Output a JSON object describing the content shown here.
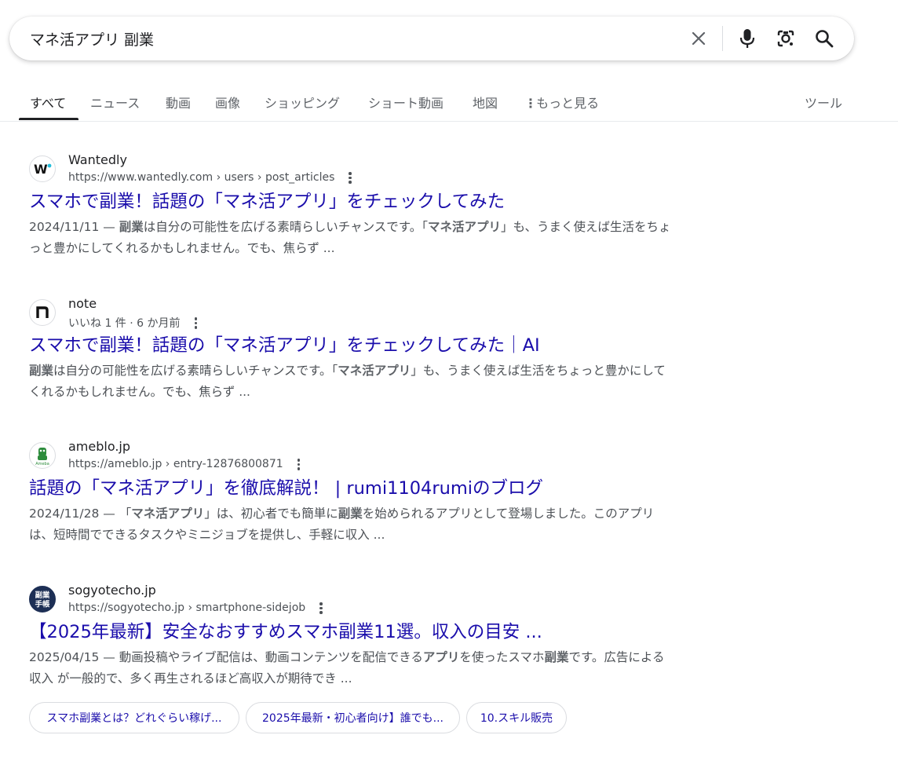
{
  "search": {
    "query": "マネ活アプリ 副業",
    "icons": [
      "close-icon",
      "mic-icon",
      "lens-icon",
      "search-icon"
    ]
  },
  "tabs": [
    {
      "label": "すべて",
      "active": true
    },
    {
      "label": "ニュース"
    },
    {
      "label": "動画"
    },
    {
      "label": "画像"
    },
    {
      "label": "ショッピング"
    },
    {
      "label": "ショート動画"
    },
    {
      "label": "地図"
    },
    {
      "label": "もっと見る"
    },
    {
      "label": "ツール"
    }
  ],
  "results": [
    {
      "site": "Wantedly",
      "url": "https://www.wantedly.com › users › post_articles",
      "title": "スマホで副業！話題の「マネ活アプリ」をチェックしてみた",
      "snippet_parts": [
        "2024/11/11 — ",
        "副業",
        "は自分の可能性を広げる素晴らしいチャンスです。「",
        "マネ活アプリ",
        "」も、うまく使えば生活をちょっと豊かにしてくれるかもしれません。でも、焦らず ..."
      ]
    },
    {
      "site": "note",
      "url": "いいね 1 件 · 6 か月前",
      "title": "スマホで副業！話題の「マネ活アプリ」をチェックしてみた｜AI",
      "snippet_parts": [
        "",
        "副業",
        "は自分の可能性を広げる素晴らしいチャンスです。「",
        "マネ活アプリ",
        "」も、うまく使えば生活をちょっと豊かにしてくれるかもしれません。でも、焦らず ..."
      ]
    },
    {
      "site": "ameblo.jp",
      "url": "https://ameblo.jp › entry-12876800871",
      "title": "話題の「マネ活アプリ」を徹底解説！ | rumi1104rumiのブログ",
      "snippet_parts": [
        "2024/11/28 — 「",
        "マネ活アプリ",
        "」は、初心者でも簡単に",
        "副業",
        "を始められるアプリとして登場しました。このアプリは、短時間でできるタスクやミニジョブを提供し、手軽に収入 ..."
      ]
    },
    {
      "site": "sogyotecho.jp",
      "url": "https://sogyotecho.jp › smartphone-sidejob",
      "title": "【2025年最新】安全なおすすめスマホ副業11選。収入の目安 ...",
      "snippet_parts": [
        "2025/04/15 — 動画投稿やライブ配信は、動画コンテンツを配信できる",
        "アプリ",
        "を使ったスマホ",
        "副業",
        "です。広告による収入 が一般的で、多く再生されるほど高収入が期待でき ..."
      ]
    }
  ],
  "favicons": {
    "wantedly": "W",
    "note": "n",
    "ameblo": "Ameba",
    "sogyotecho": "副業手帳"
  },
  "chips": [
    "スマホ副業とは？どれぐらい稼げ...",
    "2025年最新・初心者向け】誰でも...",
    "10.スキル販売"
  ],
  "colors": {
    "link": "#1a0dab",
    "snippet": "#4d5156",
    "active_tab_underline": "#202124"
  }
}
